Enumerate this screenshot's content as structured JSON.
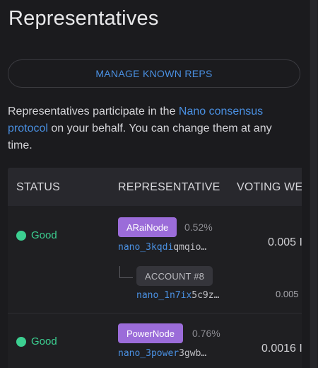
{
  "page": {
    "title": "Representatives"
  },
  "manage_button": {
    "label": "MANAGE KNOWN REPS"
  },
  "description": {
    "before": "Representatives participate in the ",
    "link": "Nano consensus protocol",
    "after": " on your behalf. You can change them at any time."
  },
  "table": {
    "headers": {
      "status": "STATUS",
      "representative": "REPRESENTATIVE",
      "voting_weight": "VOTING WE"
    },
    "rows": [
      {
        "status": "Good",
        "alias": "ARaiNode",
        "percent": "0.52%",
        "address_prefix": "nano_3kqdi",
        "address_rest": "qmqio…",
        "weight": "0.005 I",
        "account": {
          "label": "ACCOUNT #8",
          "address_prefix": "nano_1n7ix",
          "address_rest": "5c9z…",
          "weight": "0.005"
        }
      },
      {
        "status": "Good",
        "alias": "PowerNode",
        "percent": "0.76%",
        "address_prefix": "nano_3power",
        "address_rest": "3gwb…",
        "weight": "0.0016 I"
      }
    ]
  },
  "colors": {
    "accent": "#4a90e2",
    "good": "#3ccf91",
    "alias_badge": "#9b6cd9",
    "background": "#1b1b1e"
  }
}
